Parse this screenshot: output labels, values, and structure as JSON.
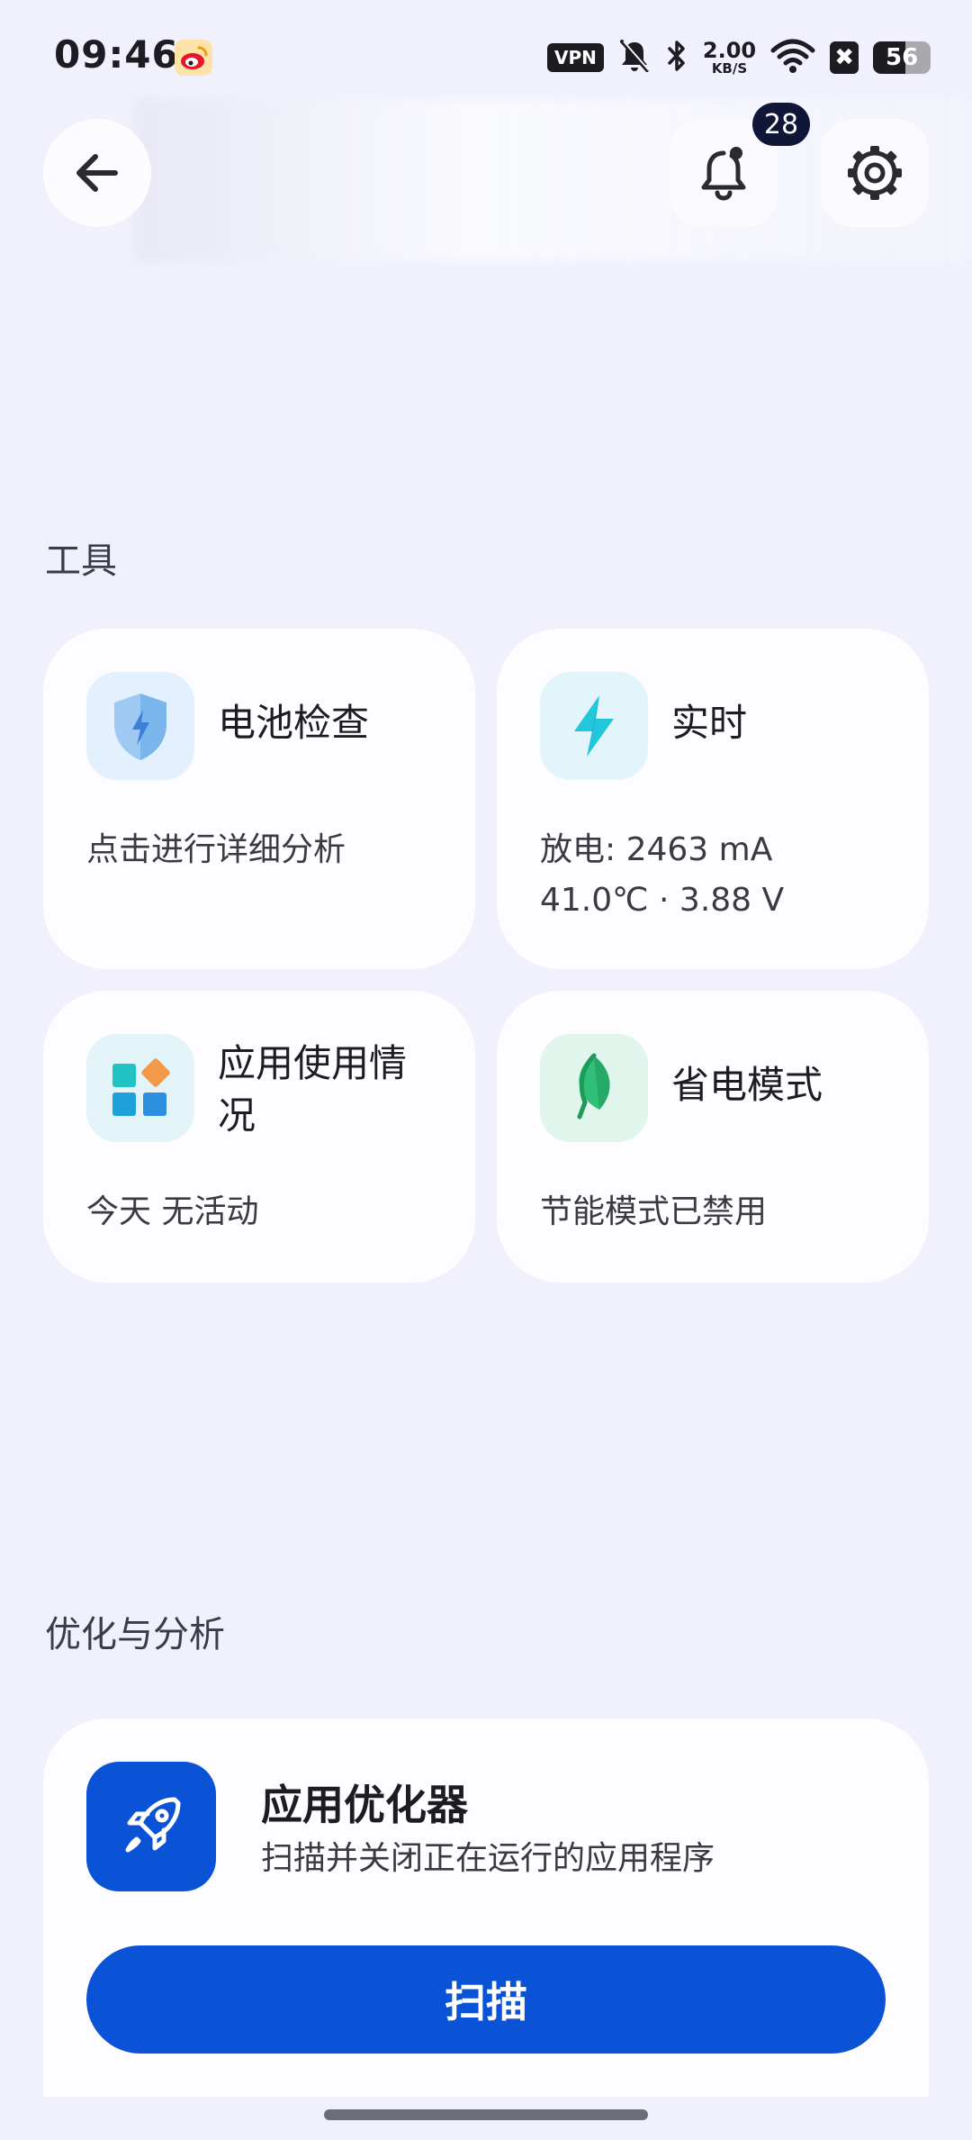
{
  "status_bar": {
    "time": "09:46",
    "vpn": "VPN",
    "net_speed_value": "2.00",
    "net_speed_unit": "KB/S",
    "x_badge": "✖",
    "battery": "56",
    "battery_level_percent": 56,
    "icons": [
      "weibo-icon",
      "mute-bell-icon",
      "bluetooth-icon",
      "wifi-icon"
    ]
  },
  "header": {
    "notification_count": "28",
    "icons": [
      "back-arrow-icon",
      "bell-icon",
      "gear-icon"
    ]
  },
  "tools": {
    "title": "工具",
    "cards": [
      {
        "title": "电池检查",
        "subtitle": "点击进行详细分析",
        "icon": "shield-bolt-icon",
        "color": "#e3f0fd"
      },
      {
        "title": "实时",
        "line1": "放电: 2463 mA",
        "line2": "41.0℃ · 3.88 V",
        "icon": "lightning-icon",
        "color": "#e2f5fb"
      },
      {
        "title_line1": "应用使用情",
        "title_line2": "况",
        "subtitle": "今天 无活动",
        "icon": "app-grid-icon",
        "color": "#e2f4f7"
      },
      {
        "title": "省电模式",
        "subtitle": "节能模式已禁用",
        "icon": "leaf-icon",
        "color": "#e0f5ec"
      }
    ]
  },
  "optimize": {
    "title": "优化与分析",
    "card_title": "应用优化器",
    "card_subtitle": "扫描并关闭正在运行的应用程序",
    "scan_label": "扫描",
    "icon": "rocket-icon",
    "accent": "#0a52d6"
  }
}
